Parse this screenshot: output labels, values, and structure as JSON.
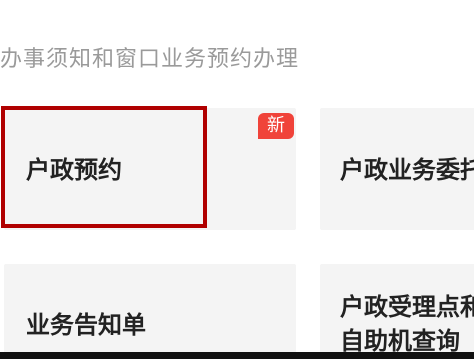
{
  "header": {
    "subtitle": "办事须知和窗口业务预约办理"
  },
  "cards": [
    {
      "label": "户政预约",
      "badge": "新"
    },
    {
      "label": "户政业务委托"
    },
    {
      "label": "业务告知单"
    },
    {
      "label": "户政受理点和自助机查询"
    }
  ],
  "colors": {
    "highlight": "#b00000",
    "badge": "#f0433a",
    "card_background": "#f4f4f4"
  }
}
